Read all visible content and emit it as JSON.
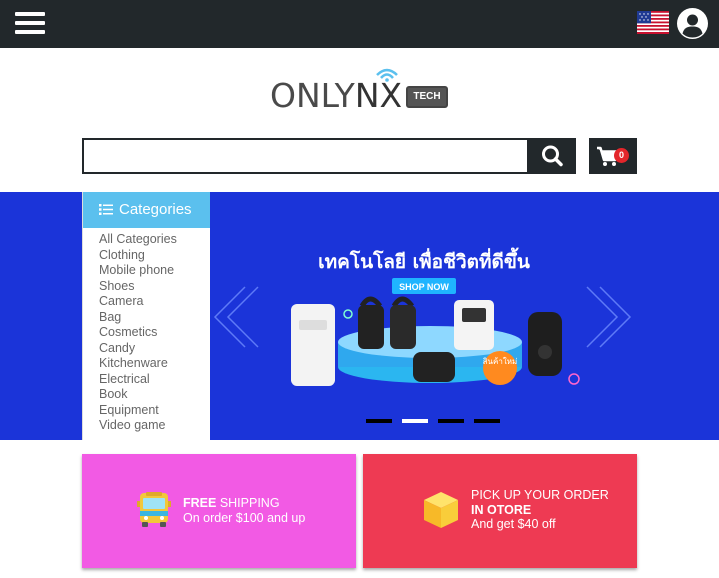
{
  "header": {
    "menu_icon": "hamburger-menu-icon",
    "flag_icon": "us-flag-icon",
    "user_icon": "user-account-icon",
    "bg_color": "#22282b"
  },
  "logo": {
    "text_plain": "ONLY",
    "text_accent": "NX",
    "badge": "TECH"
  },
  "search": {
    "value": "",
    "placeholder": "",
    "button_icon": "search-icon"
  },
  "cart": {
    "icon": "cart-icon",
    "count": "0"
  },
  "categories": {
    "title": "Categories",
    "items": [
      "All Categories",
      "Clothing",
      "Mobile phone",
      "Shoes",
      "Camera",
      "Bag",
      "Cosmetics",
      "Candy",
      "Kitchenware",
      "Electrical",
      "Book",
      "Equipment",
      "Video game"
    ],
    "header_color": "#5bc0ee"
  },
  "banner": {
    "headline": "เทคโนโลยี เพื่อชีวิตที่ดีขึ้น",
    "cta": "SHOP NOW",
    "badge": "สินค้าใหม่",
    "bg_color": "#1b34d9",
    "slides": 4,
    "active_slide": 2
  },
  "promos": [
    {
      "icon": "bus-icon",
      "line1_bold": "FREE",
      "line1_rest": " SHIPPING",
      "line2": "On order $100 and up",
      "color": "#f25ae4"
    },
    {
      "icon": "box-icon",
      "line1": "PICK UP YOUR ORDER",
      "line2_bold": "IN OTORE",
      "line3": "And get $40 off",
      "color": "#ee3a53"
    }
  ]
}
